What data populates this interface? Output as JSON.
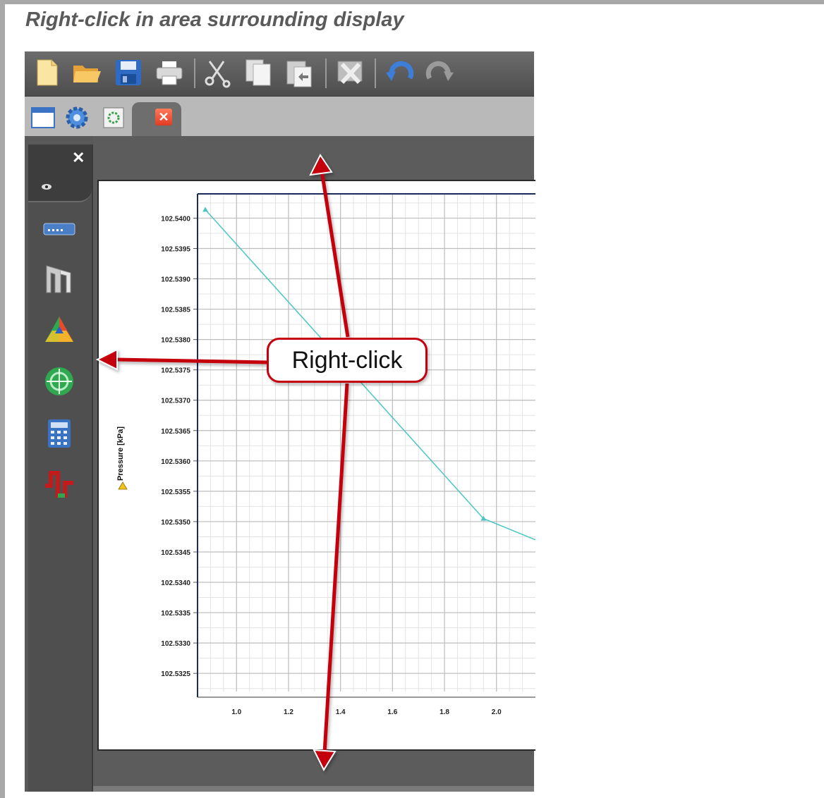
{
  "caption": "Right-click in area surrounding display",
  "callout": "Right-click",
  "toolbar": {
    "icons": [
      "new-document-icon",
      "open-folder-icon",
      "save-icon",
      "print-icon",
      "cut-icon",
      "copy-icon",
      "paste-icon",
      "delete-icon",
      "undo-icon",
      "redo-icon"
    ]
  },
  "tabs": {
    "icons": [
      "window-icon",
      "settings-gear-icon",
      "display-icon"
    ],
    "close_symbol": "✕"
  },
  "sidebar": {
    "close_symbol": "✕",
    "icons": [
      "eye-icon",
      "device-icon",
      "gateway-icon",
      "triangle-chart-icon",
      "target-icon",
      "calculator-icon",
      "signal-wave-icon"
    ]
  },
  "chart_data": {
    "type": "line",
    "ylabel": "Pressure [kPa]",
    "yticks": [
      "102.5400",
      "102.5395",
      "102.5390",
      "102.5385",
      "102.5380",
      "102.5375",
      "102.5370",
      "102.5365",
      "102.5360",
      "102.5355",
      "102.5350",
      "102.5345",
      "102.5340",
      "102.5335",
      "102.5330",
      "102.5325"
    ],
    "xticks": [
      "1.0",
      "1.2",
      "1.4",
      "1.6",
      "1.8",
      "2.0"
    ],
    "xlim": [
      0.85,
      2.15
    ],
    "ylim": [
      102.5322,
      102.5404
    ],
    "grid": true,
    "series": [
      {
        "color": "#4cc6c4",
        "x": [
          0.88,
          1.95,
          2.15
        ],
        "y": [
          102.54014,
          102.53505,
          102.5347
        ],
        "markers": [
          [
            0.88,
            102.54014
          ],
          [
            1.95,
            102.53505
          ]
        ]
      }
    ]
  },
  "colors": {
    "annotation_red": "#c40010",
    "app_background": "#595959",
    "series_line": "#4cc6c4"
  }
}
